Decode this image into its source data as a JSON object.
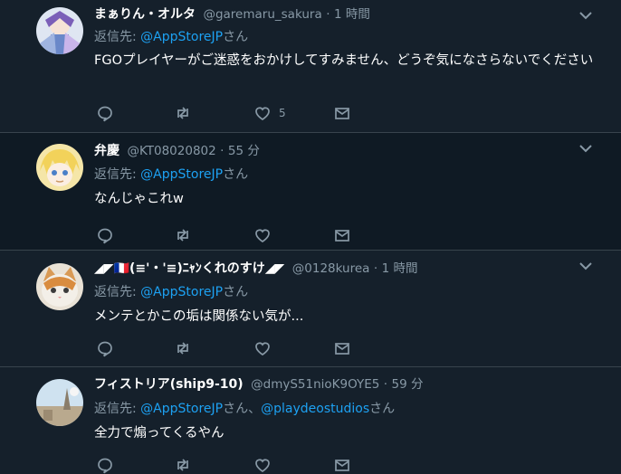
{
  "tweets": [
    {
      "name": "まぁりん・オルタ",
      "handle": "@garemaru_sakura",
      "sep": "·",
      "time": "1 時間",
      "reply_prefix": "返信先: ",
      "reply_mention": "@AppStoreJP",
      "reply_suffix": "さん",
      "text": "FGOプレイヤーがご迷惑をおかけしてすみません、どうぞ気になさらないでください",
      "like_count": "5"
    },
    {
      "name": "弁慶",
      "handle": "@KT08020802",
      "sep": "·",
      "time": "55 分",
      "reply_prefix": "返信先: ",
      "reply_mention": "@AppStoreJP",
      "reply_suffix": "さん",
      "text": "なんじゃこれw"
    },
    {
      "name": "◢◤🇫🇷(≡'・'≡)ﾆｬﾝくれのすけ◢◤",
      "handle": "@0128kurea",
      "sep": "·",
      "time": "1 時間",
      "reply_prefix": "返信先: ",
      "reply_mention": "@AppStoreJP",
      "reply_suffix": "さん",
      "text": "メンテとかこの垢は関係ない気が..."
    },
    {
      "name": "フィストリア(ship9-10)",
      "handle": "@dmyS51nioK9OYE5",
      "sep": "·",
      "time": "59 分",
      "reply_prefix": "返信先: ",
      "reply_mention": "@AppStoreJP",
      "reply_mid": "さん、",
      "reply_mention2": "@playdeostudios",
      "reply_suffix": "さん",
      "text": "全力で煽ってくるやん"
    }
  ],
  "colors": {
    "background": "#15202b",
    "secondary_text": "#8899a6",
    "link": "#1da1f2",
    "divider": "#38444d"
  },
  "icons": [
    "chevron-down-icon",
    "reply-icon",
    "retweet-icon",
    "like-icon",
    "direct-message-icon"
  ]
}
